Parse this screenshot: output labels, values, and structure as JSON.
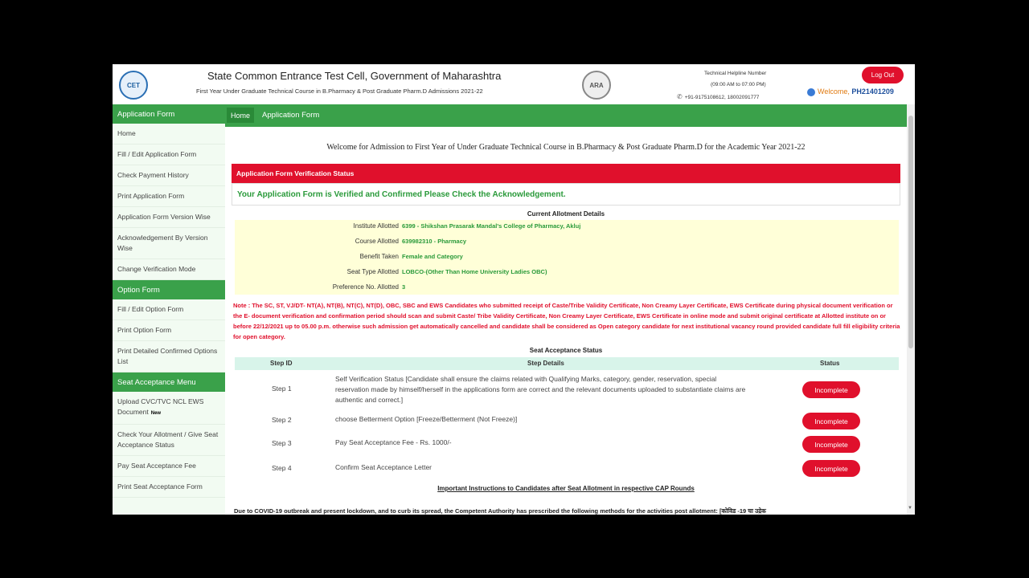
{
  "header": {
    "cet_logo_text": "CET",
    "ara_logo_text": "ARA",
    "title": "State Common Entrance Test Cell, Government of Maharashtra",
    "subtitle": "First Year Under Graduate Technical Course in B.Pharmacy & Post Graduate Pharm.D Admissions 2021-22",
    "helpline_title": "Technical Helpline Number",
    "helpline_time": "(09:00 AM to 07:00 PM)",
    "helpline_phone": "+91-9175108612, 18002091777",
    "logout_label": "Log Out",
    "welcome_label": "Welcome,",
    "user_id": "PH21401209"
  },
  "sidebar": {
    "sections": [
      {
        "title": "Application Form",
        "items": [
          "Home",
          "Fill / Edit Application Form",
          "Check Payment History",
          "Print Application Form",
          "Application Form Version Wise",
          "Acknowledgement By Version Wise",
          "Change Verification Mode"
        ]
      },
      {
        "title": "Option Form",
        "items": [
          "Fill / Edit Option Form",
          "Print Option Form",
          "Print Detailed Confirmed Options List"
        ]
      },
      {
        "title": "Seat Acceptance Menu",
        "items": [
          "Upload CVC/TVC NCL EWS Document",
          "Check Your Allotment / Give Seat Acceptance Status",
          "Pay Seat Acceptance Fee",
          "Print Seat Acceptance Form"
        ]
      }
    ],
    "new_tag": "New"
  },
  "nav": {
    "home": "Home",
    "application_form": "Application Form"
  },
  "main": {
    "welcome": "Welcome for Admission to First Year of Under Graduate Technical Course in B.Pharmacy & Post Graduate Pharm.D for the Academic Year 2021-22",
    "verification_heading": "Application Form Verification Status",
    "verification_message": "Your Application Form is Verified and Confirmed Please Check the Acknowledgement.",
    "allotment_title": "Current Allotment Details",
    "allotment": [
      {
        "label": "Institute Allotted",
        "value": "6399 - Shikshan Prasarak Mandal's College of Pharmacy, Akluj"
      },
      {
        "label": "Course Allotted",
        "value": "639982310 - Pharmacy"
      },
      {
        "label": "Benefit Taken",
        "value": "Female and Category"
      },
      {
        "label": "Seat Type Allotted",
        "value": "LOBCO-(Other Than Home University Ladies OBC)"
      },
      {
        "label": "Preference No. Allotted",
        "value": "3"
      }
    ],
    "note": "Note : The SC, ST, VJ/DT- NT(A), NT(B), NT(C), NT(D), OBC, SBC and EWS Candidates who submitted receipt of Caste/Tribe Validity Certificate, Non Creamy Layer Certificate, EWS Certificate during physical document verification or the E- document verification and confirmation period should scan and submit Caste/ Tribe Validity Certificate, Non Creamy Layer Certificate, EWS Certificate in online mode and submit original certificate at Allotted institute on or before 22/12/2021 up to 05.00 p.m. otherwise such admission get automatically cancelled and candidate shall be considered as Open category candidate for next institutional vacancy round provided candidate full fill eligibility criteria for open category.",
    "seat_title": "Seat Acceptance Status",
    "table_headers": {
      "step_id": "Step ID",
      "step_details": "Step Details",
      "status": "Status"
    },
    "steps": [
      {
        "id": "Step 1",
        "details": "Self Verification Status [Candidate shall ensure the claims related with Qualifying Marks, category, gender, reservation, special reservation made by himself/herself in the applications form are correct and the relevant documents uploaded to substantiate claims are authentic and correct.]",
        "status": "Incomplete"
      },
      {
        "id": "Step 2",
        "details": "choose Betterment Option [Freeze/Betterment (Not Freeze)]",
        "status": "Incomplete"
      },
      {
        "id": "Step 3",
        "details": "Pay Seat Acceptance Fee - Rs. 1000/-",
        "status": "Incomplete"
      },
      {
        "id": "Step 4",
        "details": "Confirm Seat Acceptance Letter",
        "status": "Incomplete"
      }
    ],
    "instructions_title": "Important Instructions to Candidates after Seat Allotment in respective CAP Rounds",
    "covid_text": "Due to COVID-19 outbreak and present lockdown, and to curb its spread, the Competent Authority has prescribed the following methods for the activities post allotment: [कोविड -19 चा उद्रेक"
  }
}
